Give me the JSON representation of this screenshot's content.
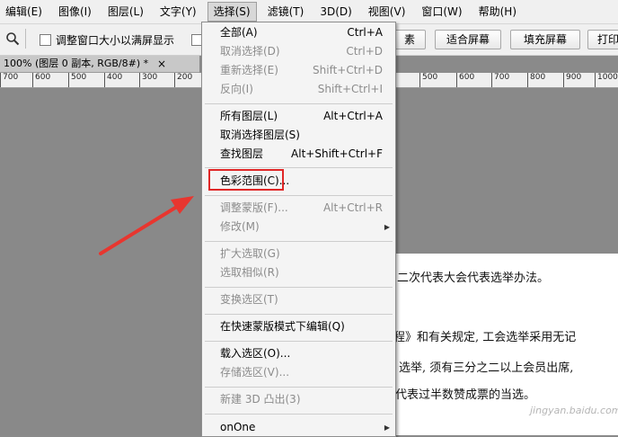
{
  "menubar": {
    "items": [
      {
        "label": "编辑(E)"
      },
      {
        "label": "图像(I)"
      },
      {
        "label": "图层(L)"
      },
      {
        "label": "文字(Y)"
      },
      {
        "label": "选择(S)"
      },
      {
        "label": "滤镜(T)"
      },
      {
        "label": "3D(D)"
      },
      {
        "label": "视图(V)"
      },
      {
        "label": "窗口(W)"
      },
      {
        "label": "帮助(H)"
      }
    ]
  },
  "options": {
    "resize_label": "调整窗口大小以满屏显示",
    "pixel_btn": "素",
    "fit_btn": "适合屏幕",
    "fill_btn": "填充屏幕",
    "print_btn": "打印"
  },
  "doc_tab": {
    "title": "100% (图层 0 副本, RGB/8#) *",
    "close": "×"
  },
  "ruler_left": [
    "700",
    "600",
    "500",
    "400",
    "300",
    "200"
  ],
  "ruler_right": [
    "500",
    "600",
    "700",
    "800",
    "900",
    "1000"
  ],
  "document": {
    "line1": "二次代表大会代表选举办法。",
    "line2": "程》和有关规定, 工会选举采用无记",
    "line3": "选举, 须有三分之二以上会员出席,",
    "line4": "代表过半数赞成票的当选。"
  },
  "watermark": "jingyan.baidu.com",
  "dropdown": {
    "items": [
      {
        "label": "全部(A)",
        "shortcut": "Ctrl+A",
        "disabled": false
      },
      {
        "label": "取消选择(D)",
        "shortcut": "Ctrl+D",
        "disabled": true
      },
      {
        "label": "重新选择(E)",
        "shortcut": "Shift+Ctrl+D",
        "disabled": true
      },
      {
        "label": "反向(I)",
        "shortcut": "Shift+Ctrl+I",
        "disabled": true
      },
      {
        "label": "所有图层(L)",
        "shortcut": "Alt+Ctrl+A",
        "disabled": false
      },
      {
        "label": "取消选择图层(S)",
        "shortcut": "",
        "disabled": false
      },
      {
        "label": "查找图层",
        "shortcut": "Alt+Shift+Ctrl+F",
        "disabled": false
      },
      {
        "label": "色彩范围(C)...",
        "shortcut": "",
        "disabled": false
      },
      {
        "label": "调整蒙版(F)...",
        "shortcut": "Alt+Ctrl+R",
        "disabled": true
      },
      {
        "label": "修改(M)",
        "shortcut": "",
        "disabled": true
      },
      {
        "label": "扩大选取(G)",
        "shortcut": "",
        "disabled": true
      },
      {
        "label": "选取相似(R)",
        "shortcut": "",
        "disabled": true
      },
      {
        "label": "变换选区(T)",
        "shortcut": "",
        "disabled": true
      },
      {
        "label": "在快速蒙版模式下编辑(Q)",
        "shortcut": "",
        "disabled": false
      },
      {
        "label": "载入选区(O)...",
        "shortcut": "",
        "disabled": false
      },
      {
        "label": "存储选区(V)...",
        "shortcut": "",
        "disabled": true
      },
      {
        "label": "新建 3D 凸出(3)",
        "shortcut": "",
        "disabled": true
      },
      {
        "label": "onOne",
        "shortcut": "",
        "disabled": false
      }
    ]
  },
  "colors": {
    "highlight": "#e02727",
    "arrow": "#e8362f"
  }
}
